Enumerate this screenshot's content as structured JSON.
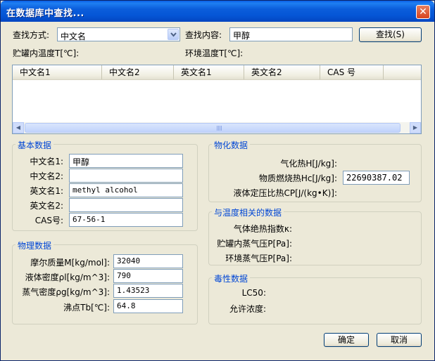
{
  "window": {
    "title": "在数据库中查找...",
    "close_glyph": "✕"
  },
  "search": {
    "method_label": "查找方式:",
    "method_value": "中文名",
    "content_label": "查找内容:",
    "content_value": "甲醇",
    "button_label": "查找(S)"
  },
  "temps": {
    "tank_label": "贮罐内温度T[℃]:",
    "env_label": "环境温度T[℃]:"
  },
  "results": {
    "columns": [
      "中文名1",
      "中文名2",
      "英文名1",
      "英文名2",
      "CAS 号"
    ],
    "scroll_left": "◀",
    "scroll_right": "▶"
  },
  "basic": {
    "title": "基本数据",
    "labels": [
      "中文名1:",
      "中文名2:",
      "英文名1:",
      "英文名2:",
      "CAS号:"
    ],
    "values": [
      "甲醇",
      "",
      "methyl alcohol",
      "",
      "67-56-1"
    ]
  },
  "physical": {
    "title": "物理数据",
    "labels": [
      "摩尔质量M[kg/mol]:",
      "液体密度ρl[kg/m^3]:",
      "蒸气密度ρg[kg/m^3]:",
      "沸点Tb[℃]:"
    ],
    "values": [
      "32040",
      "790",
      "1.43523",
      "64.8"
    ]
  },
  "physchem": {
    "title": "物化数据",
    "labels": [
      "气化热H[J/kg]:",
      "物质燃烧热Hc[J/kg]:",
      "液体定压比热CP[J/(kg•K)]:"
    ],
    "combustion_value": "22690387.02"
  },
  "temperature_related": {
    "title": "与温度相关的数据",
    "labels": [
      "气体绝热指数κ:",
      "贮罐内蒸气压P[Pa]:",
      "环境蒸气压P[Pa]:"
    ]
  },
  "toxicity": {
    "title": "毒性数据",
    "labels": [
      "LC50:",
      "允许浓度:"
    ]
  },
  "footer": {
    "ok_label": "确定",
    "cancel_label": "取消"
  }
}
